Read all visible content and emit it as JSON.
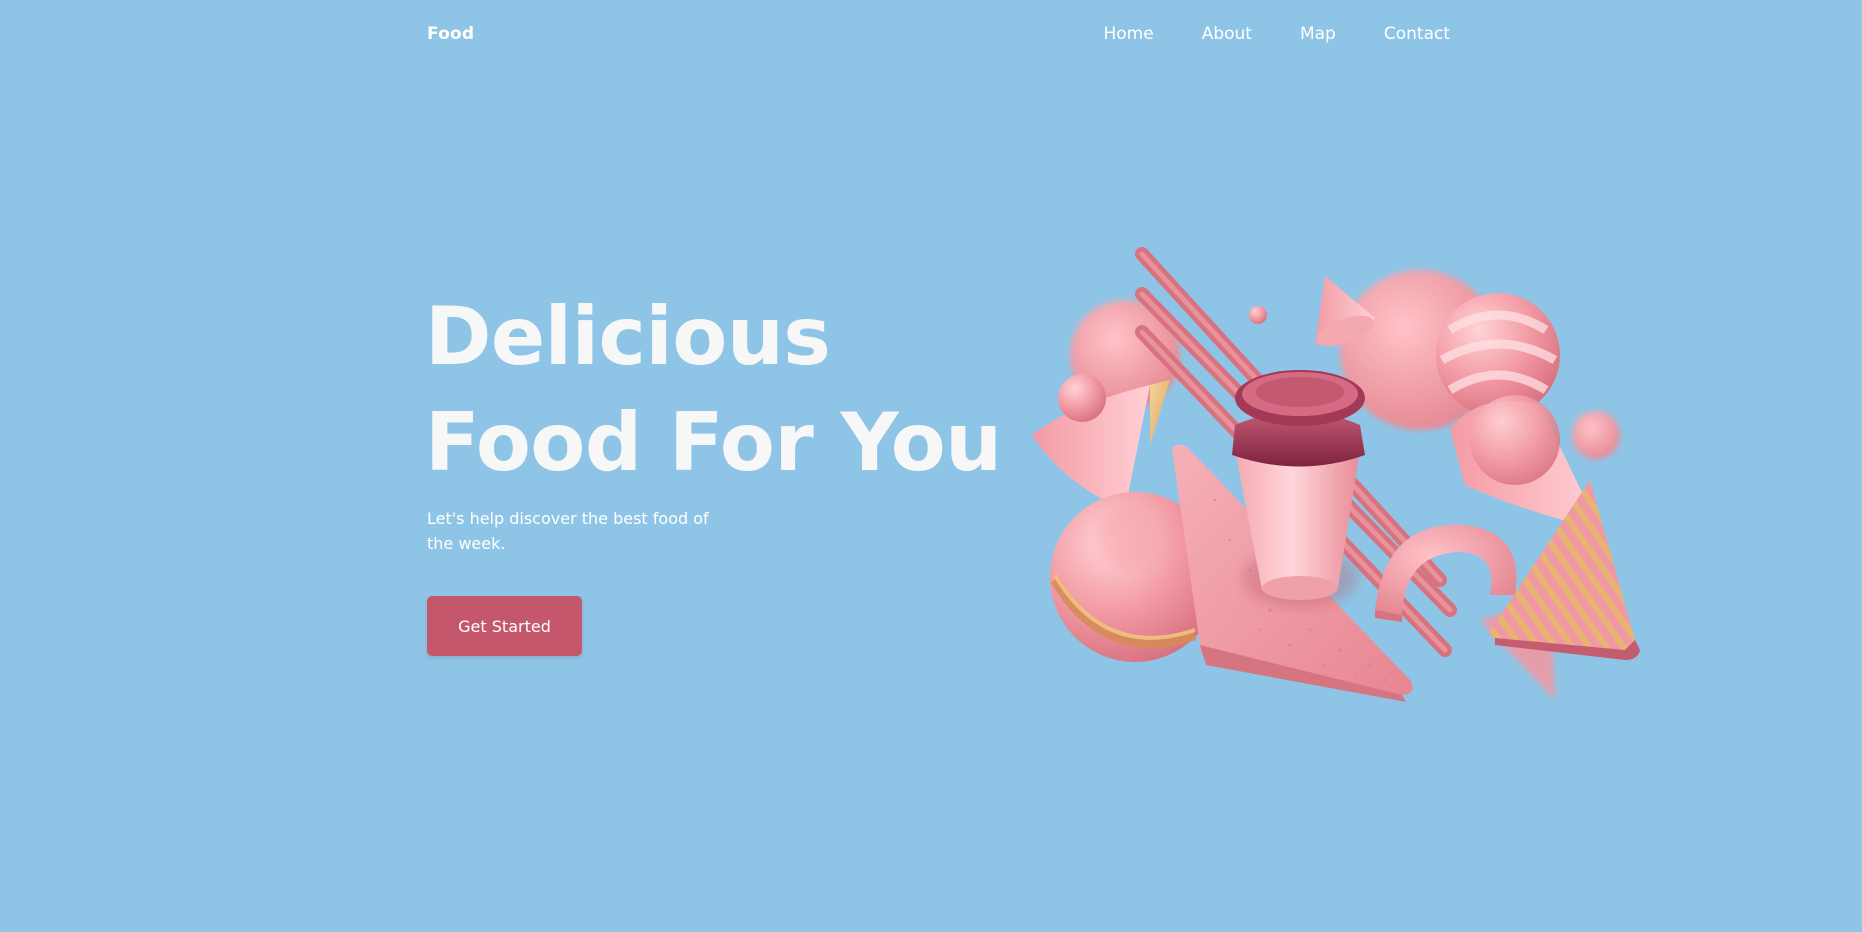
{
  "nav": {
    "logo": "Food",
    "links": [
      "Home",
      "About",
      "Map",
      "Contact"
    ]
  },
  "hero": {
    "title_line1": "Delicious",
    "title_line2": "Food For You",
    "subtitle": "Let's help discover the best food of the week.",
    "cta_label": "Get Started"
  },
  "colors": {
    "background": "#8ec5e6",
    "accent": "#c5576d",
    "heading": "#f7f7f7",
    "shape_pink": "#ef9aa3",
    "shape_dark": "#8a2a45",
    "shape_gold": "#e4b36b"
  },
  "illustration": {
    "icon": "3d-food-shapes-illustration"
  }
}
